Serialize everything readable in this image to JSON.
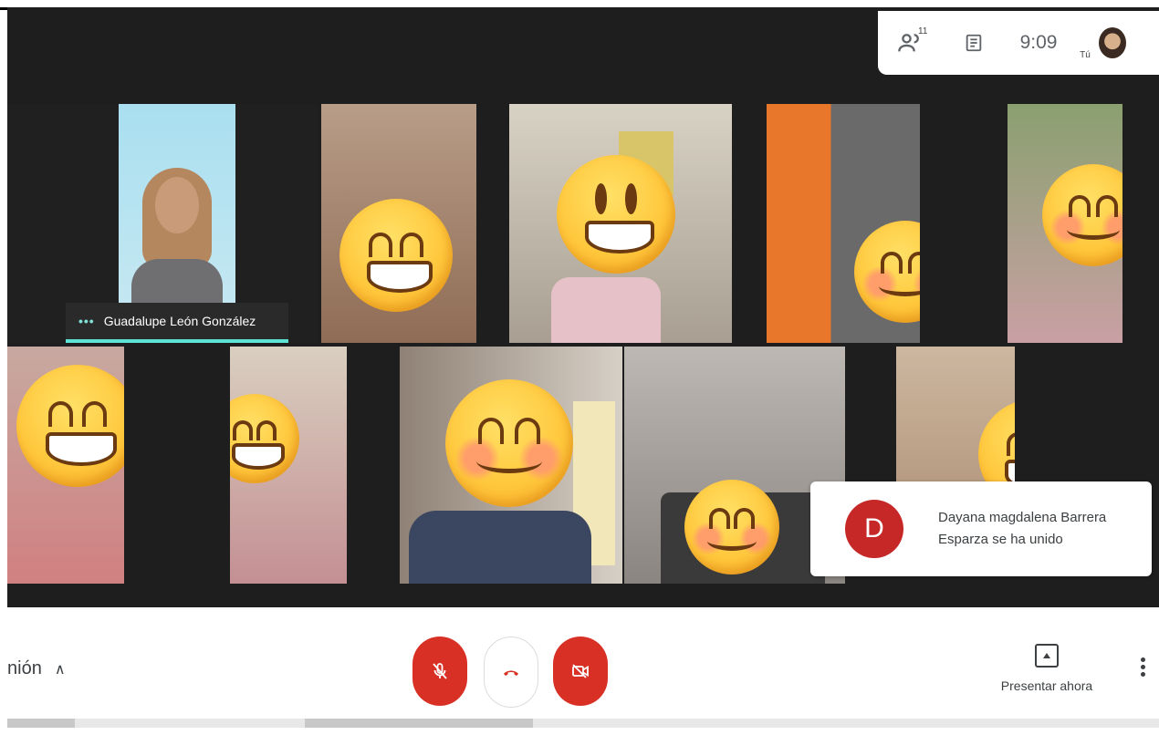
{
  "topbar": {
    "participants_count": "11",
    "clock": "9:09",
    "you_label": "Tú",
    "icons": [
      "people-icon",
      "chat-icon"
    ]
  },
  "speaker": {
    "name": "Guadalupe León González"
  },
  "toast": {
    "initial": "D",
    "message_line1": "Dayana magdalena Barrera",
    "message_line2": "Esparza se ha unido"
  },
  "bottom": {
    "meeting_label": "nión",
    "present_label": "Presentar ahora"
  },
  "colors": {
    "end_call": "#d93025",
    "speaking_indicator": "#5ce3d4",
    "toast_avatar": "#c62828"
  }
}
